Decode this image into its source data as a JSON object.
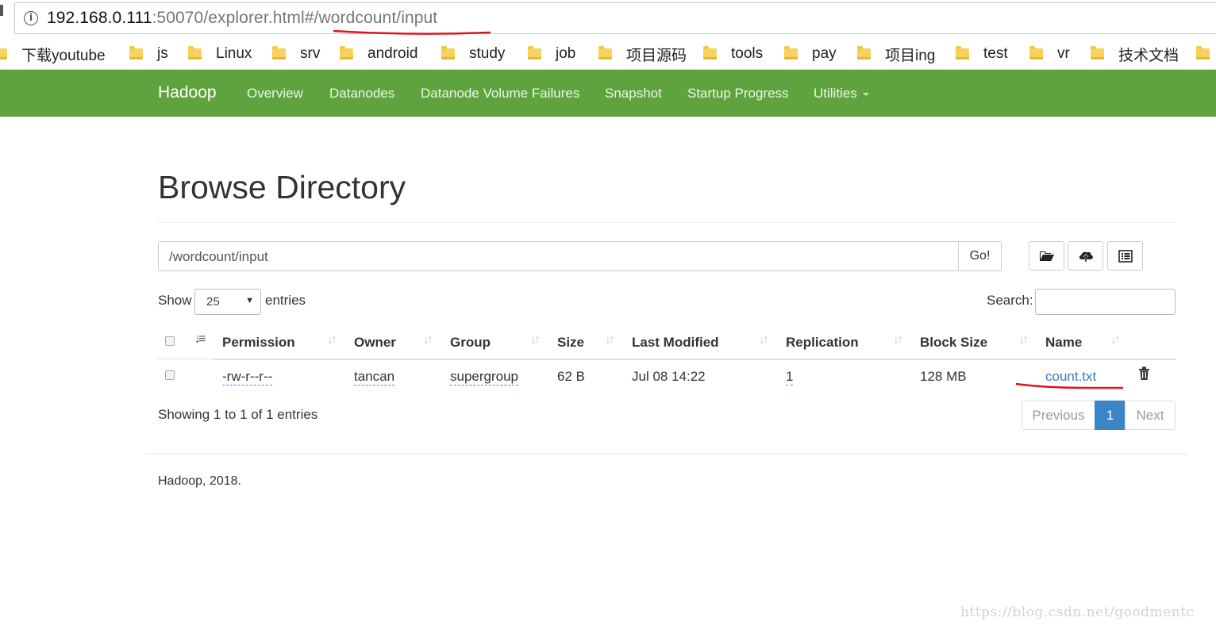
{
  "browser": {
    "url_host": "192.168.0.111",
    "url_rest": ":50070/explorer.html#/wordcount/input"
  },
  "bookmarks": [
    "下载youtube",
    "js",
    "Linux",
    "srv",
    "android",
    "study",
    "job",
    "项目源码",
    "tools",
    "pay",
    "项目ing",
    "test",
    "vr",
    "技术文档"
  ],
  "navbar": {
    "brand": "Hadoop",
    "items": [
      "Overview",
      "Datanodes",
      "Datanode Volume Failures",
      "Snapshot",
      "Startup Progress",
      "Utilities"
    ]
  },
  "page": {
    "title": "Browse Directory",
    "path_value": "/wordcount/input",
    "go_label": "Go!",
    "show_label": "Show",
    "entries_label": "entries",
    "page_length": "25",
    "search_label": "Search:",
    "search_value": "",
    "icons": [
      "folder-open-icon",
      "cloud-upload-icon",
      "list-alt-icon"
    ]
  },
  "table": {
    "columns": [
      "Permission",
      "Owner",
      "Group",
      "Size",
      "Last Modified",
      "Replication",
      "Block Size",
      "Name"
    ],
    "rows": [
      {
        "permission": "-rw-r--r--",
        "owner": "tancan",
        "group": "supergroup",
        "size": "62 B",
        "last_modified": "Jul 08 14:22",
        "replication": "1",
        "block_size": "128 MB",
        "name": "count.txt"
      }
    ]
  },
  "info": "Showing 1 to 1 of 1 entries",
  "pagination": {
    "previous": "Previous",
    "current": "1",
    "next": "Next"
  },
  "footer": "Hadoop, 2018.",
  "watermark": "https://blog.csdn.net/goodmentc",
  "colors": {
    "navbar": "#5fa33e",
    "link": "#3a7bbf",
    "active_page": "#3a84c8",
    "annotation": "#e0141e"
  }
}
